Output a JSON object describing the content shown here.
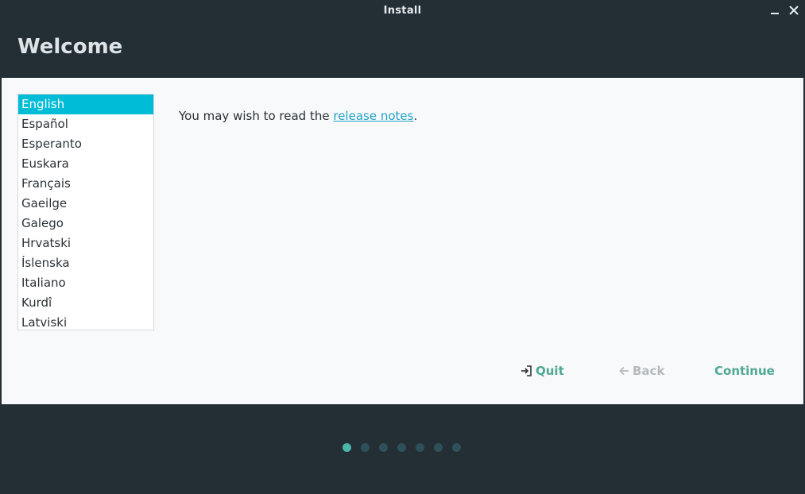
{
  "window": {
    "title": "Install"
  },
  "header": {
    "title": "Welcome"
  },
  "languages": {
    "selected": "English",
    "items": [
      "English",
      "Español",
      "Esperanto",
      "Euskara",
      "Français",
      "Gaeilge",
      "Galego",
      "Hrvatski",
      "Íslenska",
      "Italiano",
      "Kurdî",
      "Latviski"
    ]
  },
  "release": {
    "prefix": "You may wish to read the ",
    "link": "release notes",
    "suffix": "."
  },
  "buttons": {
    "quit": "Quit",
    "back": "Back",
    "continue": "Continue"
  },
  "progress": {
    "current_step": 1,
    "total_steps": 7
  },
  "icons": {
    "minimize": "minimize-icon",
    "close": "close-icon",
    "quit": "exit-icon",
    "back": "arrow-left-icon"
  },
  "colors": {
    "accent": "#00bcd7",
    "button_text": "#4ea893",
    "link": "#25a3c6",
    "dot_active": "#4cb5a8",
    "dot_inactive": "#2e5058",
    "chrome_background": "#232f35"
  }
}
